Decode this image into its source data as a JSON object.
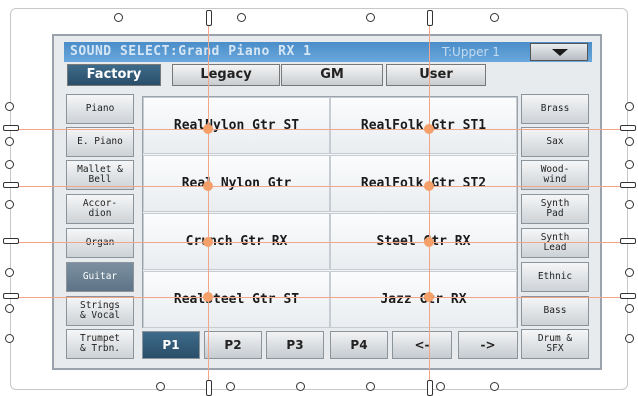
{
  "header": {
    "title": "SOUND SELECT:Grand Piano RX 1",
    "track": "T:Upper 1"
  },
  "bank_tabs": [
    "Factory",
    "Legacy",
    "GM",
    "User"
  ],
  "active_bank_tab": "Factory",
  "categories_left": [
    "Piano",
    "E. Piano",
    "Mallet &\nBell",
    "Accor-\ndion",
    "Organ",
    "Guitar",
    "Strings\n& Vocal",
    "Trumpet\n& Trbn."
  ],
  "categories_right": [
    "Brass",
    "Sax",
    "Wood-\nwind",
    "Synth\nPad",
    "Synth\nLead",
    "Ethnic",
    "Bass",
    "Drum &\nSFX"
  ],
  "active_category": "Guitar",
  "sounds": [
    "RealNylon Gtr ST",
    "RealFolk Gtr ST1",
    "Real Nylon Gtr",
    "RealFolk Gtr ST2",
    "Crunch Gtr RX",
    "Steel Gtr RX",
    "RealSteel Gtr ST",
    "Jazz Gtr RX"
  ],
  "pages": [
    "P1",
    "P2",
    "P3",
    "P4",
    "<-",
    "->"
  ],
  "active_page": "P1",
  "colors": {
    "accent_blue": "#4a8dc8",
    "active_tab": "#2a4e69",
    "callout_orange": "#f5a06a"
  }
}
